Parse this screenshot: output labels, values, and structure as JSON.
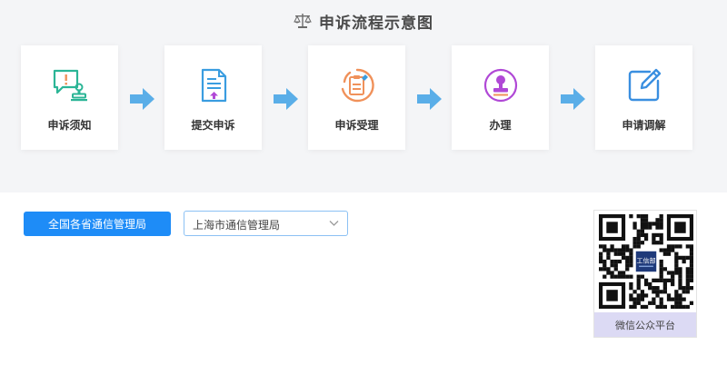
{
  "header": {
    "title": "申诉流程示意图",
    "title_icon": "scale-icon"
  },
  "steps": [
    {
      "label": "申诉须知",
      "icon": "notice-stamp-icon",
      "color": "#2bb596"
    },
    {
      "label": "提交申诉",
      "icon": "submit-document-icon",
      "color": "#3a9de0"
    },
    {
      "label": "申诉受理",
      "icon": "accept-clipboard-icon",
      "color": "#f0915a"
    },
    {
      "label": "办理",
      "icon": "seal-stamp-icon",
      "color": "#b048d6"
    },
    {
      "label": "申请调解",
      "icon": "edit-icon",
      "color": "#3a8fe0"
    }
  ],
  "controls": {
    "all_provinces_button": "全国各省通信管理局",
    "province_select_value": "上海市通信管理局"
  },
  "qr": {
    "caption": "微信公众平台",
    "center_logo_text": "工信部"
  },
  "colors": {
    "accent": "#1e8cf7",
    "arrow": "#5aaee8",
    "section_bg": "#f4f5f7",
    "qr_caption_bg": "#dcdaf4"
  }
}
